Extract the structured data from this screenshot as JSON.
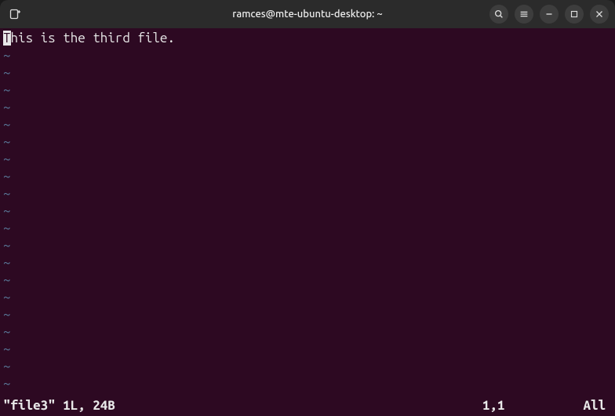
{
  "window": {
    "title": "ramces@mte-ubuntu-desktop: ~"
  },
  "icons": {
    "newtab": "newtab-icon",
    "search": "search-icon",
    "menu": "hamburger-icon",
    "minimize": "minimize-icon",
    "maximize": "maximize-icon",
    "close": "close-icon"
  },
  "editor": {
    "cursor_char": "T",
    "rest_of_line": "his is the third file.",
    "tilde": "~"
  },
  "status": {
    "file_info": "\"file3\" 1L, 24B",
    "position": "1,1",
    "percent": "All"
  }
}
